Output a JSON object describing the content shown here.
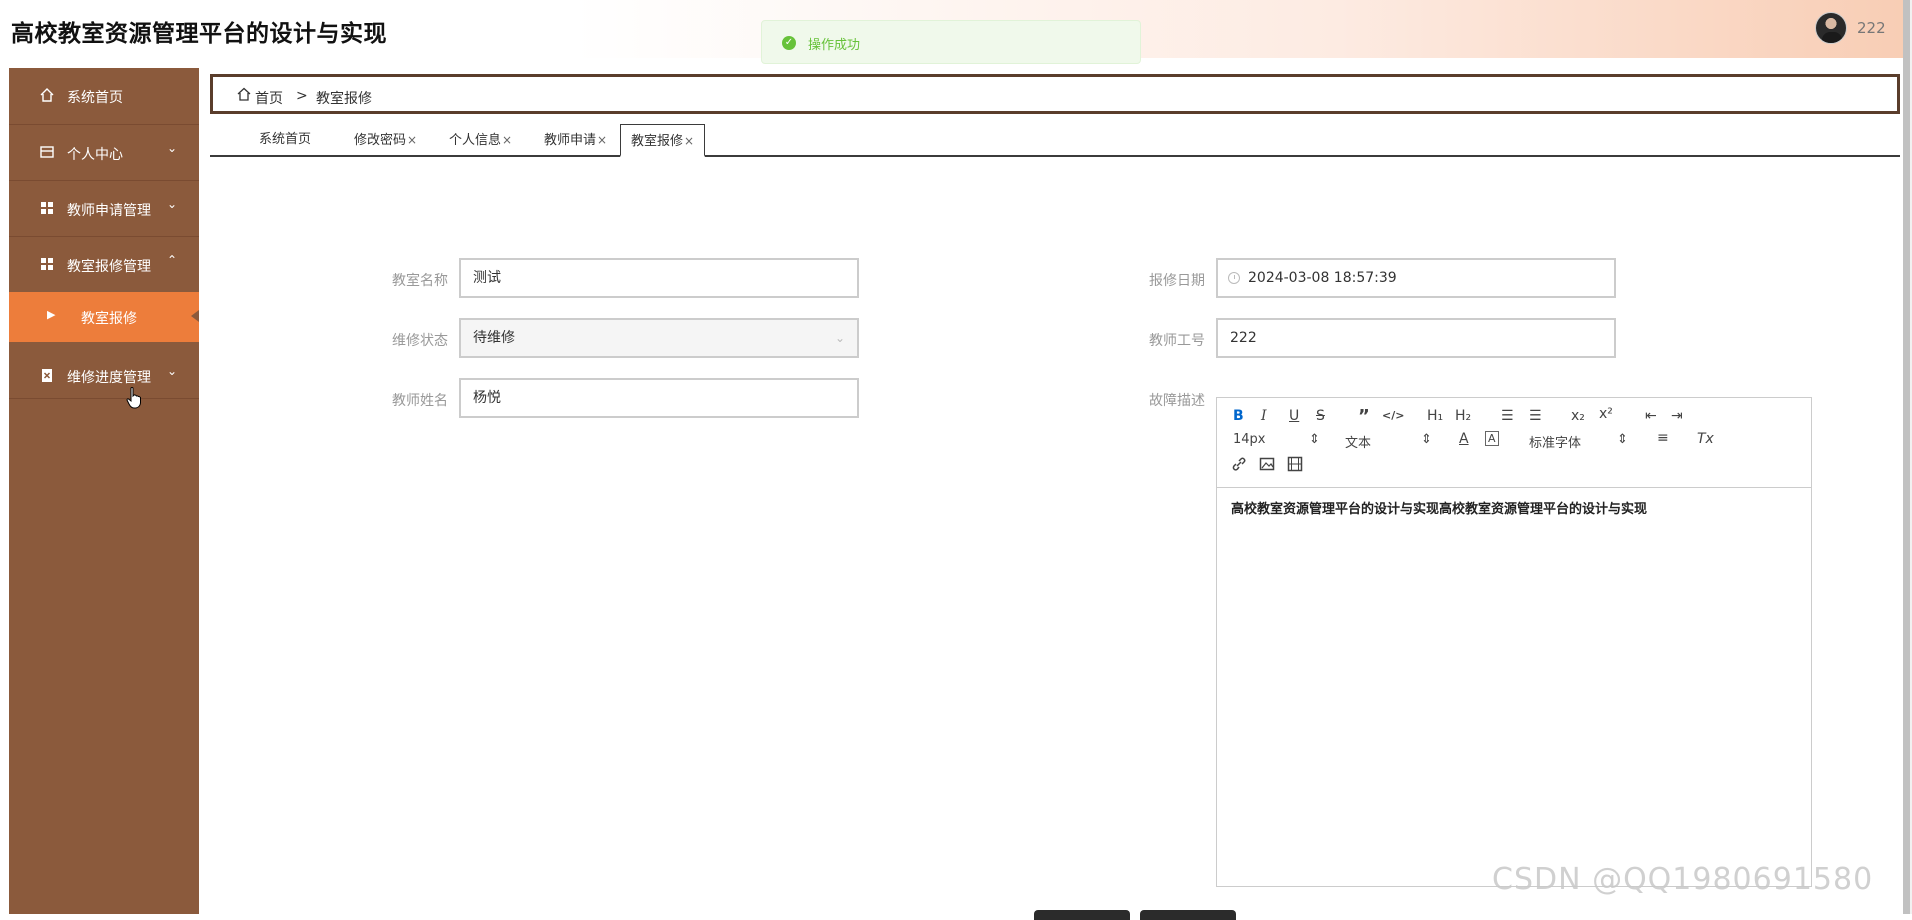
{
  "header": {
    "title": "高校教室资源管理平台的设计与实现",
    "username": "222"
  },
  "toast": {
    "text": "操作成功",
    "icon": "success-check-icon"
  },
  "sidebar": {
    "items": [
      {
        "label": "系统首页",
        "icon": "home-icon"
      },
      {
        "label": "个人中心",
        "icon": "card-icon",
        "arrow": "⌄"
      },
      {
        "label": "教师申请管理",
        "icon": "grid-icon",
        "arrow": "⌄"
      },
      {
        "label": "教室报修管理",
        "icon": "grid-icon",
        "arrow": "⌃"
      },
      {
        "label": "维修进度管理",
        "icon": "clipboard-icon",
        "arrow": "⌄"
      }
    ],
    "submenu": {
      "label": "教室报修"
    }
  },
  "breadcrumb": {
    "home": "首页",
    "separator": ">",
    "current": "教室报修"
  },
  "tabs": [
    {
      "label": "系统首页",
      "closable": false
    },
    {
      "label": "修改密码",
      "closable": true
    },
    {
      "label": "个人信息",
      "closable": true
    },
    {
      "label": "教师申请",
      "closable": true
    },
    {
      "label": "教室报修",
      "closable": true,
      "active": true
    }
  ],
  "tab_close": "×",
  "form": {
    "classroom_name": {
      "label": "教室名称",
      "value": "测试"
    },
    "repair_status": {
      "label": "维修状态",
      "value": "待维修"
    },
    "teacher_name": {
      "label": "教师姓名",
      "value": "杨悦"
    },
    "repair_date": {
      "label": "报修日期",
      "value": "2024-03-08 18:57:39"
    },
    "teacher_id": {
      "label": "教师工号",
      "value": "222"
    },
    "fault_desc": {
      "label": "故障描述"
    }
  },
  "editor": {
    "toolbar": {
      "bold": "B",
      "italic": "I",
      "underline": "U",
      "strike": "S",
      "quote": "”",
      "code": "</>",
      "h1": "H₁",
      "h2": "H₂",
      "ordered_list": "☰",
      "bullet_list": "☰",
      "subscript": "x₂",
      "superscript": "x²",
      "outdent": "⇤",
      "indent": "⇥",
      "size": "14px",
      "type": "文本",
      "font": "标准字体",
      "align": "≡",
      "clean": "Tx"
    },
    "content": "高校教室资源管理平台的设计与实现高校教室资源管理平台的设计与实现"
  },
  "watermark": "CSDN @QQ1980691580",
  "colors": {
    "sidebar": "#8b5a3c",
    "active_menu": "#ed7d3b",
    "success": "#67c23a"
  }
}
